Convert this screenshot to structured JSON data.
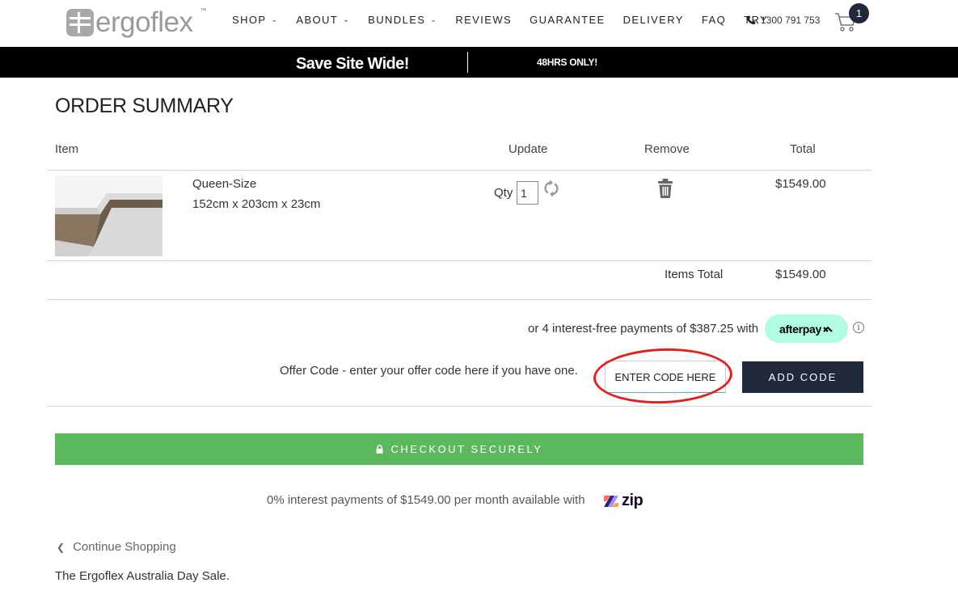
{
  "header": {
    "logo_text": "ergoflex",
    "logo_tm": "™",
    "nav": [
      {
        "label": "SHOP",
        "has_dropdown": true
      },
      {
        "label": "ABOUT",
        "has_dropdown": true
      },
      {
        "label": "BUNDLES",
        "has_dropdown": true
      },
      {
        "label": "REVIEWS",
        "has_dropdown": false
      },
      {
        "label": "GUARANTEE",
        "has_dropdown": false
      },
      {
        "label": "DELIVERY",
        "has_dropdown": false
      },
      {
        "label": "FAQ",
        "has_dropdown": false
      },
      {
        "label": "TRY",
        "has_dropdown": false
      }
    ],
    "phone": "1300 791 753",
    "cart_count": "1"
  },
  "promo": {
    "left_text": "Save Site Wide!",
    "right_text": "48HRS ONLY!"
  },
  "summary": {
    "title": "ORDER SUMMARY",
    "columns": {
      "item": "Item",
      "update": "Update",
      "remove": "Remove",
      "total": "Total"
    },
    "line_item": {
      "name": "Queen-Size",
      "size": "152cm x 203cm x 23cm",
      "qty_label": "Qty",
      "qty": "1",
      "total": "$1549.00"
    },
    "items_total_label": "Items Total",
    "items_total": "$1549.00"
  },
  "afterpay": {
    "text": "or 4 interest-free payments of $387.25 with",
    "badge": "afterpay",
    "info": "i"
  },
  "offer": {
    "text": "Offer Code - enter your offer code here if you have one.",
    "placeholder": "ENTER CODE HERE",
    "button": "ADD CODE"
  },
  "checkout": {
    "label": "CHECKOUT SECURELY"
  },
  "zip": {
    "text": "0% interest payments of $1549.00 per month available with",
    "logo": "zip"
  },
  "continue_shopping": "Continue Shopping",
  "footer_note": "The Ergoflex Australia Day Sale.",
  "colors": {
    "navy": "#20293a",
    "checkout_green": "#5cb85c",
    "afterpay_mint": "#b2fce4",
    "annotation_red": "#e0231a"
  }
}
